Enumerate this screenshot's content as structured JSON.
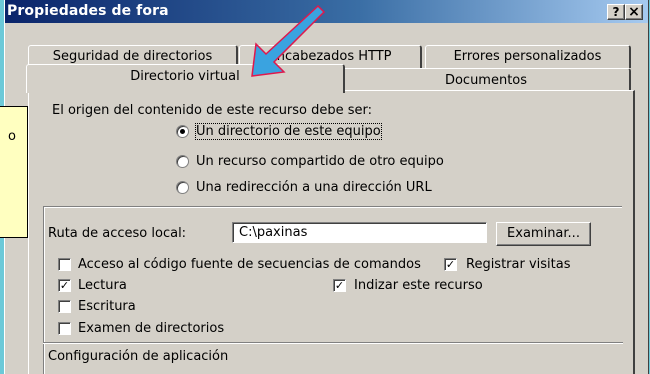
{
  "window": {
    "title": "Propiedades de fora",
    "help_label": "?",
    "close_label": "×"
  },
  "tabs": {
    "row1": [
      "Seguridad de directorios",
      "Encabezados HTTP",
      "Errores personalizados"
    ],
    "row2": [
      "Directorio virtual",
      "Documentos"
    ],
    "active": "Directorio virtual"
  },
  "content_source": {
    "prompt": "El origen del contenido de este recurso debe ser:",
    "options": [
      {
        "label": "Un directorio de este equipo",
        "selected": true
      },
      {
        "label": "Un recurso compartido de otro equipo",
        "selected": false
      },
      {
        "label": "Una redirección a una dirección URL",
        "selected": false
      }
    ]
  },
  "local_path": {
    "label": "Ruta de acceso local:",
    "value": "C:\\paxinas",
    "browse_label": "Examinar..."
  },
  "checkboxes": {
    "script_source": {
      "label": "Acceso al código fuente de secuencias de comandos",
      "checked": false
    },
    "log_visits": {
      "label": "Registrar visitas",
      "checked": true
    },
    "read": {
      "label": "Lectura",
      "checked": true
    },
    "index": {
      "label": "Indizar este recurso",
      "checked": true
    },
    "write": {
      "label": "Escritura",
      "checked": false
    },
    "browse_dirs": {
      "label": "Examen de directorios",
      "checked": false
    }
  },
  "app_config": {
    "label": "Configuración de aplicación"
  },
  "note": {
    "text": "o"
  },
  "colors": {
    "dialog_bg": "#d4d0c8",
    "desktop_bg": "#6cc9d8",
    "title_gradient_start": "#0a246a",
    "title_gradient_end": "#a6caf0",
    "arrow": "#3aa3e0",
    "note_bg": "#ffffc0"
  }
}
